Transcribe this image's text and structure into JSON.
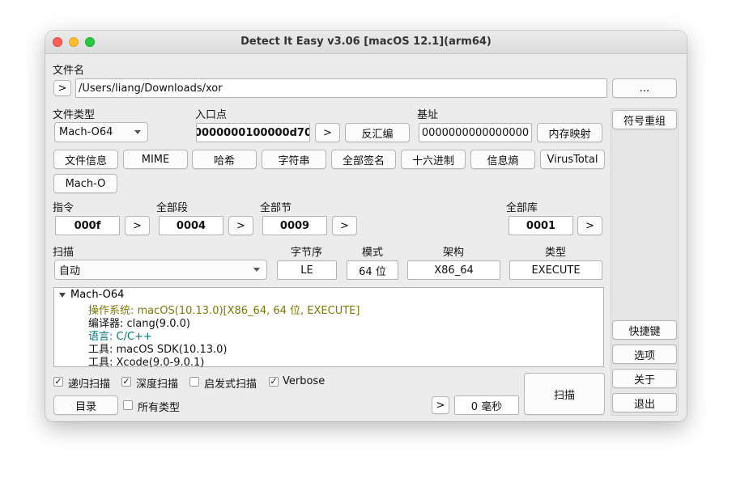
{
  "window": {
    "title": "Detect It Easy v3.06 [macOS 12.1](arm64)"
  },
  "file": {
    "label": "文件名",
    "open_glyph": ">",
    "path": "/Users/liang/Downloads/xor",
    "browse_label": "..."
  },
  "labels": {
    "file_type": "文件类型",
    "entry_point": "入口点",
    "base_address": "基址",
    "instructions": "指令",
    "all_segments": "全部段",
    "all_sections": "全部节",
    "all_libraries": "全部库",
    "scan": "扫描",
    "endianness": "字节序",
    "mode": "模式",
    "arch": "架构",
    "type": "类型"
  },
  "file_type": {
    "value": "Mach-O64"
  },
  "entry_point": {
    "value": "0000000100000d70",
    "goto_glyph": ">",
    "disasm_label": "反汇编"
  },
  "base_address": {
    "value": "0000000000000000",
    "memmap_label": "内存映射"
  },
  "tools": [
    "文件信息",
    "MIME",
    "哈希",
    "字符串",
    "全部签名",
    "十六进制",
    "信息熵",
    "VirusTotal",
    "Mach-O"
  ],
  "counts": {
    "instructions": "000f",
    "segments": "0004",
    "sections": "0009",
    "libraries": "0001",
    "goto_glyph": ">"
  },
  "scan": {
    "mode": "自动",
    "endianness": "LE",
    "bits": "64 位",
    "arch": "X86_64",
    "type": "EXECUTE"
  },
  "results": {
    "root": "Mach-O64",
    "items": [
      {
        "text": "操作系统: macOS(10.13.0)[X86_64, 64 位, EXECUTE]",
        "color": "#7a7a00"
      },
      {
        "text": "编译器: clang(9.0.0)",
        "color": "#111111"
      },
      {
        "text": "语言: C/C++",
        "color": "#007a7a"
      },
      {
        "text": "工具: macOS SDK(10.13.0)",
        "color": "#111111"
      },
      {
        "text": "工具: Xcode(9.0-9.0.1)",
        "color": "#111111"
      }
    ]
  },
  "options": {
    "recursive": {
      "label": "递归扫描",
      "checked": "✓"
    },
    "deep": {
      "label": "深度扫描",
      "checked": "✓"
    },
    "heuristic": {
      "label": "启发式扫描",
      "checked": ""
    },
    "verbose": {
      "label": "Verbose",
      "checked": "✓"
    },
    "all_types": {
      "label": "所有类型",
      "checked": ""
    }
  },
  "bottom": {
    "directory_label": "目录",
    "time_glyph": ">",
    "elapsed": "0 毫秒",
    "scan_button": "扫描"
  },
  "side": {
    "symbol_demangle": "符号重组",
    "shortcuts": "快捷键",
    "options": "选项",
    "about": "关于",
    "exit": "退出"
  }
}
